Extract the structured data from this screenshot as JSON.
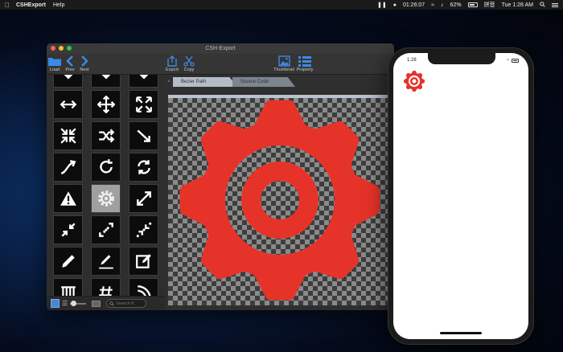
{
  "menubar": {
    "app_name": "CSHExport",
    "menus": [
      "Help"
    ],
    "clock": "01:26:07",
    "battery_percent": "62%",
    "input_method": "拼音",
    "datetime": "Tue 1:28 AM"
  },
  "window": {
    "title": "CSH-Export",
    "toolbar": {
      "load": "Load",
      "prev": "Prev",
      "next": "Next",
      "export": "Export",
      "copy": "Copy",
      "thumbnail": "Thumbnail",
      "property": "Property"
    },
    "tabs": {
      "close": "×",
      "bezier": "Bezier Path",
      "source": "Source Code",
      "more": "»"
    },
    "search_placeholder": "Search K"
  },
  "icons": [
    "arrow-down-thick",
    "arrow-down",
    "arrow-down",
    "arrows-horizontal",
    "arrows-move",
    "arrows-expand",
    "arrows-compress",
    "shuffle",
    "arrow-diagonal",
    "arrow-curve",
    "rotate-cw",
    "refresh",
    "warning",
    "gear-selected",
    "arrows-diagonal-expand",
    "arrows-diagonal-compress",
    "dotted-diagonal-expand",
    "dotted-diagonal-compress",
    "pencil",
    "pencil-line",
    "pencil-square",
    "columns",
    "hash",
    "rss"
  ],
  "colors": {
    "accent_red": "#e63329",
    "toolbar_blue": "#3d8ae6",
    "selected_cell": "#a0a0a0"
  },
  "phone": {
    "time": "1:28"
  }
}
